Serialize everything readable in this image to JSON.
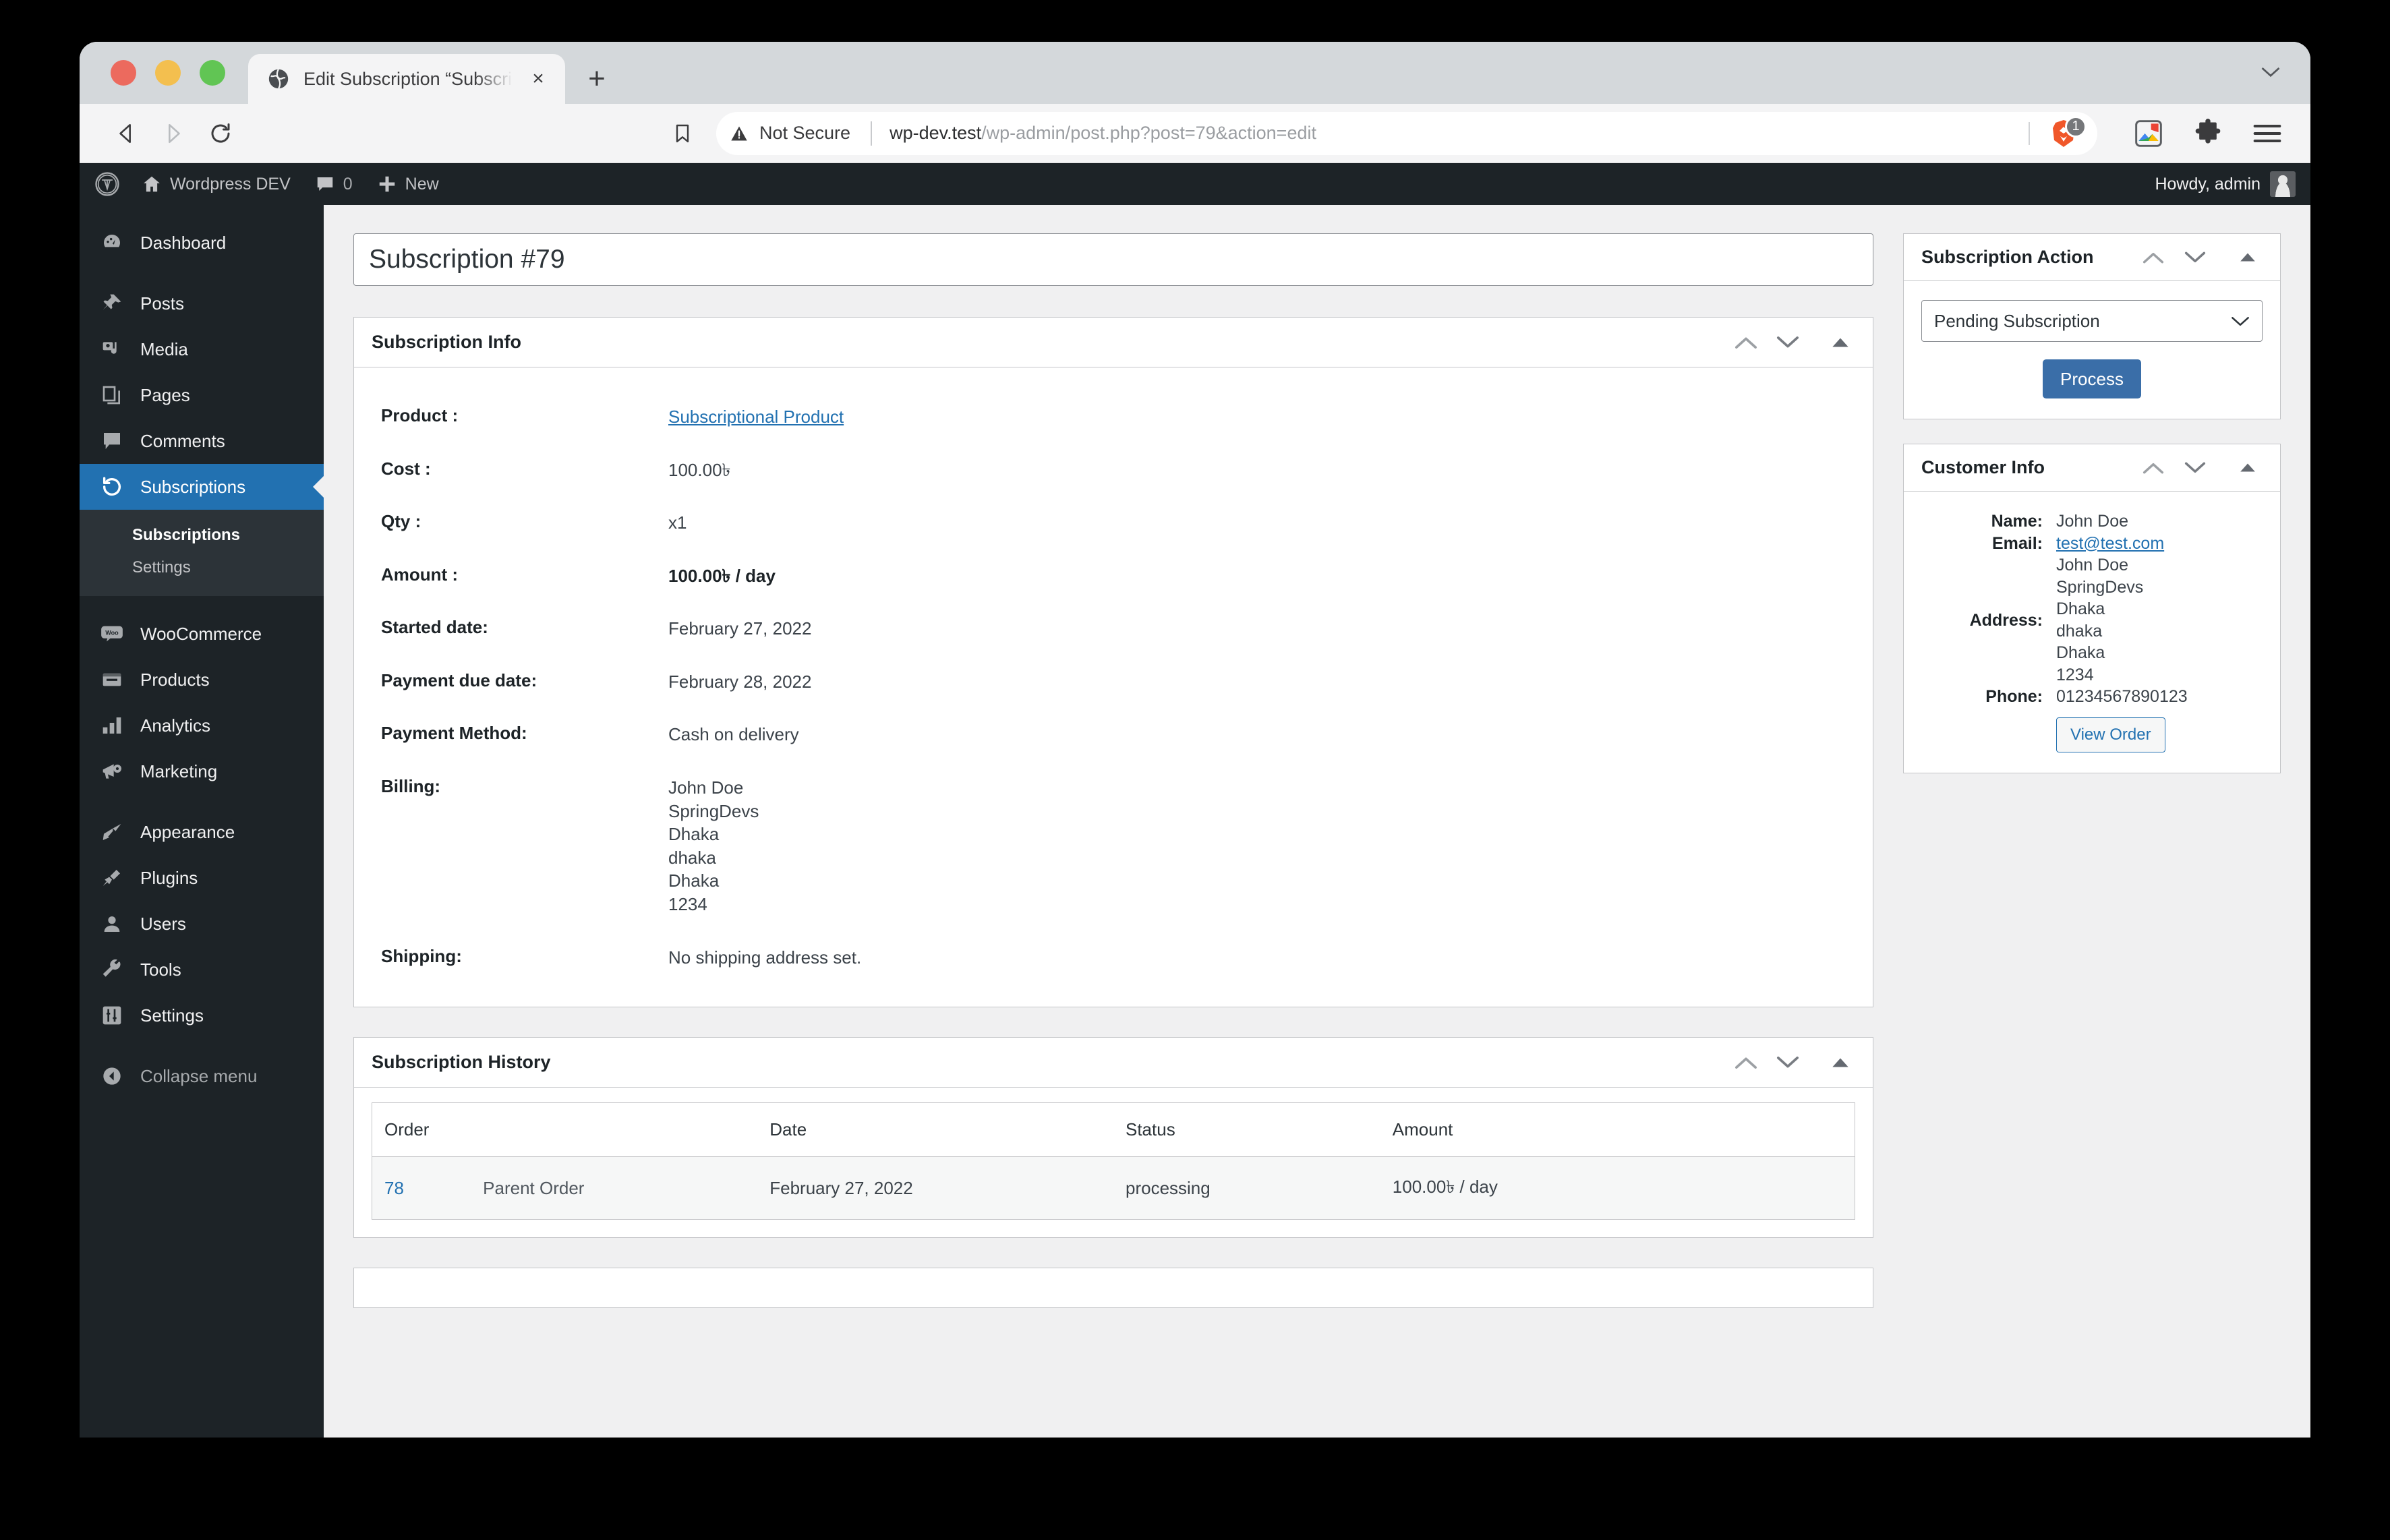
{
  "browser": {
    "tab": {
      "title": "Edit Subscription “Subscription",
      "favicon": "globe-icon",
      "close": "×"
    },
    "new_tab": "+",
    "nav": {
      "back": "back-icon",
      "forward": "forward-icon",
      "reload": "reload-icon"
    },
    "omnibox": {
      "security_label": "Not Secure",
      "url_host": "wp-dev.test",
      "url_path": "/wp-admin/post.php?post=79&action=edit",
      "shield_badge": "1"
    }
  },
  "adminbar": {
    "logo": "wordpress-logo",
    "site_name": "Wordpress DEV",
    "comments_count": "0",
    "new_label": "New",
    "howdy": "Howdy, admin"
  },
  "adminmenu": {
    "items": [
      {
        "label": "Dashboard",
        "icon": "dashboard-icon",
        "current": false
      },
      {
        "label": "Posts",
        "icon": "pin-icon",
        "current": false
      },
      {
        "label": "Media",
        "icon": "media-icon",
        "current": false
      },
      {
        "label": "Pages",
        "icon": "pages-icon",
        "current": false
      },
      {
        "label": "Comments",
        "icon": "comment-icon",
        "current": false
      },
      {
        "label": "Subscriptions",
        "icon": "update-icon",
        "current": true
      },
      {
        "label": "WooCommerce",
        "icon": "woo-icon",
        "current": false
      },
      {
        "label": "Products",
        "icon": "products-icon",
        "current": false
      },
      {
        "label": "Analytics",
        "icon": "analytics-icon",
        "current": false
      },
      {
        "label": "Marketing",
        "icon": "megaphone-icon",
        "current": false
      },
      {
        "label": "Appearance",
        "icon": "brush-icon",
        "current": false
      },
      {
        "label": "Plugins",
        "icon": "plug-icon",
        "current": false
      },
      {
        "label": "Users",
        "icon": "user-icon",
        "current": false
      },
      {
        "label": "Tools",
        "icon": "wrench-icon",
        "current": false
      },
      {
        "label": "Settings",
        "icon": "settings-icon",
        "current": false
      }
    ],
    "submenu": [
      {
        "label": "Subscriptions",
        "current": true
      },
      {
        "label": "Settings",
        "current": false
      }
    ],
    "collapse": {
      "label": "Collapse menu",
      "icon": "collapse-icon"
    }
  },
  "page": {
    "title": "Subscription #79"
  },
  "subscription_info": {
    "panel_title": "Subscription Info",
    "rows": [
      {
        "label": "Product :",
        "value": "Subscriptional Product",
        "link": true
      },
      {
        "label": "Cost :",
        "value": "100.00৳"
      },
      {
        "label": "Qty :",
        "value": "x1"
      },
      {
        "label": "Amount :",
        "value": "100.00৳  / day",
        "bold": true
      },
      {
        "label": "Started date:",
        "value": "February 27, 2022"
      },
      {
        "label": "Payment due date:",
        "value": "February 28, 2022"
      },
      {
        "label": "Payment Method:",
        "value": "Cash on delivery"
      },
      {
        "label": "Billing:",
        "value": "John Doe\nSpringDevs\nDhaka\ndhaka\nDhaka\n1234"
      },
      {
        "label": "Shipping:",
        "value": "No shipping address set."
      }
    ]
  },
  "subscription_history": {
    "panel_title": "Subscription History",
    "columns": [
      "Order",
      "Date",
      "Status",
      "Amount"
    ],
    "rows": [
      {
        "order": "78",
        "order_tag": "Parent Order",
        "date": "February 27, 2022",
        "status": "processing",
        "amount": "100.00৳  / day"
      }
    ]
  },
  "subscription_action": {
    "panel_title": "Subscription Action",
    "select_value": "Pending Subscription",
    "process_label": "Process"
  },
  "customer_info": {
    "panel_title": "Customer Info",
    "name_label": "Name:",
    "name_value": "John Doe",
    "email_label": "Email:",
    "email_value": "test@test.com",
    "address_label": "Address:",
    "address_value": "John Doe\nSpringDevs\nDhaka\ndhaka\nDhaka\n1234",
    "phone_label": "Phone:",
    "phone_value": "01234567890123",
    "view_order_label": "View Order"
  },
  "colors": {
    "wp_blue": "#2271b1",
    "sidebar_bg": "#1d2327",
    "submenu_bg": "#2c3338",
    "content_bg": "#f0f0f1",
    "button_blue": "#3a6ea8",
    "link_blue": "#2271b1"
  }
}
